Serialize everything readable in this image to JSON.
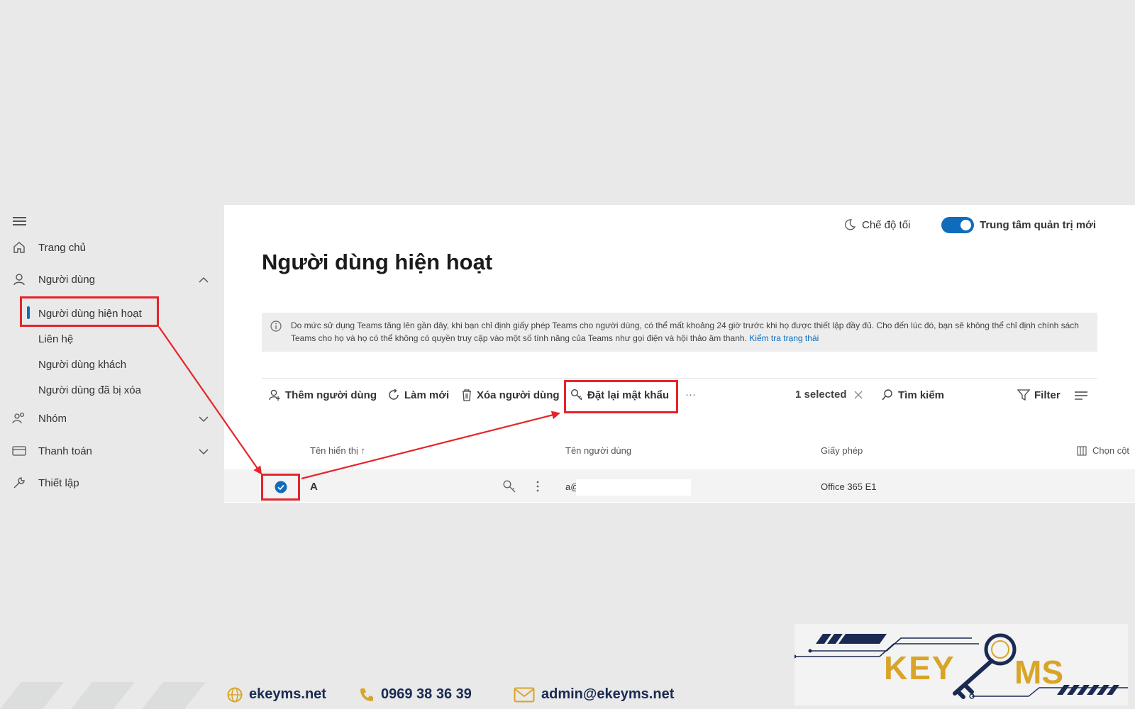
{
  "sidebar": {
    "items": [
      {
        "label": "Trang chủ",
        "icon": "home-icon"
      },
      {
        "label": "Người dùng",
        "icon": "user-icon"
      },
      {
        "label": "Nhóm",
        "icon": "group-icon"
      },
      {
        "label": "Thanh toán",
        "icon": "credit-card-icon"
      },
      {
        "label": "Thiết lập",
        "icon": "wrench-icon"
      }
    ],
    "sub_items": [
      "Người dùng hiện hoạt",
      "Liên hệ",
      "Người dùng khách",
      "Người dùng đã bị xóa"
    ]
  },
  "header": {
    "dark_mode_label": "Chế độ tối",
    "new_admin_label": "Trung tâm quản trị mới",
    "new_admin_on": true
  },
  "page": {
    "title": "Người dùng hiện hoạt",
    "notice_text": "Do mức sử dụng Teams tăng lên gần đây, khi bạn chỉ định giấy phép Teams cho người dùng, có thể mất khoảng 24 giờ trước khi họ được thiết lập đầy đủ. Cho đến lúc đó, bạn sẽ không thể chỉ định chính sách Teams cho họ và họ có thể không có quyền truy cập vào một số tính năng của Teams như gọi điện và hội thảo âm thanh.",
    "notice_link": "Kiểm tra trạng thái"
  },
  "toolbar": {
    "add_user": "Thêm người dùng",
    "refresh": "Làm mới",
    "delete_user": "Xóa người dùng",
    "reset_password": "Đặt lại mật khẩu",
    "more": "···",
    "selected": "1 selected",
    "search": "Tìm kiếm",
    "filter": "Filter"
  },
  "table": {
    "columns": [
      "Tên hiển thị ↑",
      "Tên người dùng",
      "Giấy phép",
      "Chọn cột"
    ],
    "rows": [
      {
        "display_name": "A",
        "username": "a@",
        "license": "Office 365 E1",
        "selected": true
      }
    ]
  },
  "footer": {
    "website": "ekeyms.net",
    "phone": "0969 38 36 39",
    "email": "admin@ekeyms.net",
    "brand_color": "#1a2a52",
    "accent_color": "#d9a528"
  },
  "colors": {
    "accent": "#0f6cbd",
    "highlight": "#e5242b",
    "background": "#e8e9e8"
  }
}
